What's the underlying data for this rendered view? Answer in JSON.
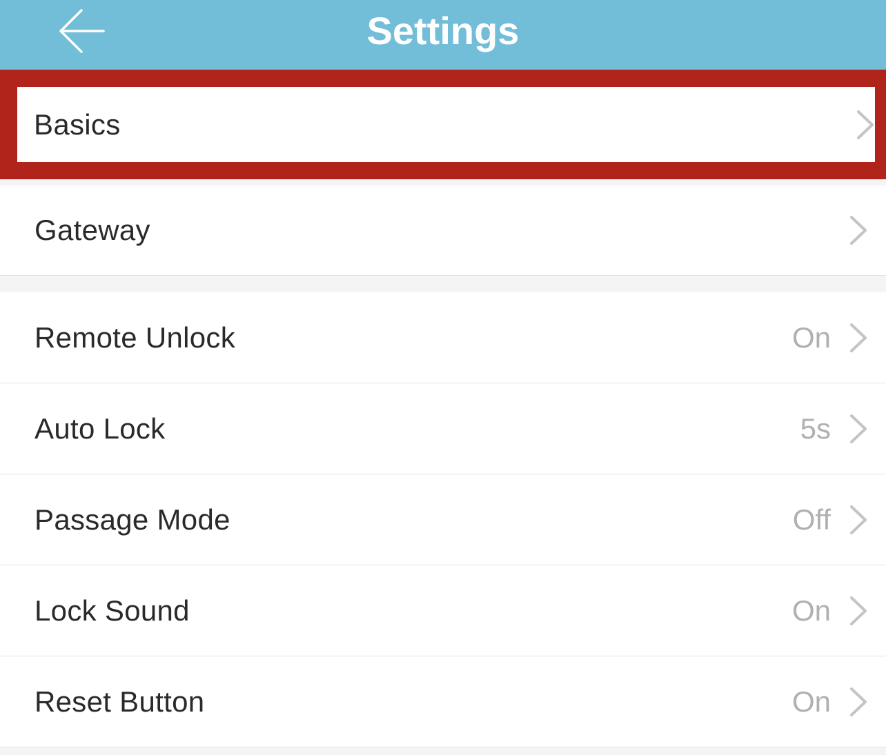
{
  "header": {
    "title": "Settings",
    "back_icon": "arrow-left-icon",
    "background": "#72bdd8"
  },
  "highlight_color": "#b1241b",
  "groups": [
    {
      "items": [
        {
          "label": "Basics",
          "value": "",
          "highlighted": true
        },
        {
          "label": "Gateway",
          "value": ""
        }
      ]
    },
    {
      "items": [
        {
          "label": "Remote Unlock",
          "value": "On"
        },
        {
          "label": "Auto Lock",
          "value": "5s"
        },
        {
          "label": "Passage Mode",
          "value": "Off"
        },
        {
          "label": "Lock Sound",
          "value": "On"
        },
        {
          "label": "Reset Button",
          "value": "On"
        }
      ]
    }
  ],
  "chevron_icon": "chevron-right-icon"
}
